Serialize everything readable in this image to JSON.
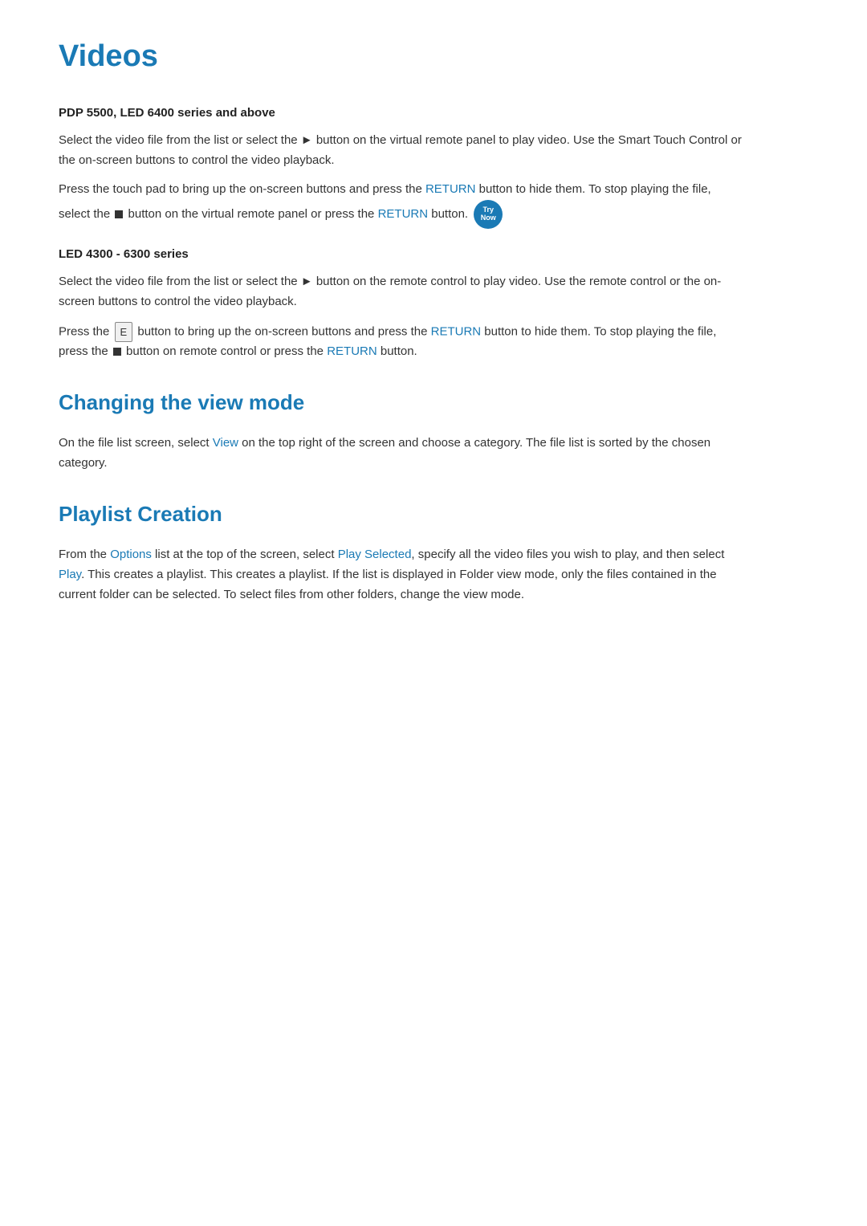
{
  "page": {
    "title": "Videos",
    "accent_color": "#1a7ab5"
  },
  "sections": {
    "pdp_heading": "PDP 5500, LED 6400 series and above",
    "pdp_para1": "Select the video file from the list or select the ► button on the virtual remote panel to play video. Use the Smart Touch Control or the on-screen buttons to control the video playback.",
    "pdp_para2_part1": "Press the touch pad to bring up the on-screen buttons and press the ",
    "pdp_para2_return1": "RETURN",
    "pdp_para2_part2": " button to hide them. To stop playing the file, select the ",
    "pdp_para2_part3": " button on the virtual remote panel or press the ",
    "pdp_para2_return2": "RETURN",
    "pdp_para2_part4": " button.",
    "try_now_line1": "Try",
    "try_now_line2": "Now",
    "led_heading": "LED 4300 - 6300 series",
    "led_para1": "Select the video file from the list or select the ► button on the remote control to play video. Use the remote control or the on-screen buttons to control the video playback.",
    "led_para2_part1": "Press the ",
    "led_para2_e": "E",
    "led_para2_part2": "  button to bring up the on-screen buttons and press the ",
    "led_para2_return1": "RETURN",
    "led_para2_part3": " button to hide them. To stop playing the file, press the ",
    "led_para2_part4": " button on remote control or press the ",
    "led_para2_return2": "RETURN",
    "led_para2_part5": " button.",
    "view_mode_title": "Changing the view mode",
    "view_mode_para_part1": "On the file list screen, select ",
    "view_mode_view": "View",
    "view_mode_para_part2": " on the top right of the screen and choose a category. The file list is sorted by the chosen category.",
    "playlist_title": "Playlist Creation",
    "playlist_para_part1": "From the ",
    "playlist_options": "Options",
    "playlist_para_part2": " list at the top of the screen, select ",
    "playlist_play_selected": "Play Selected",
    "playlist_para_part3": ", specify all the video files you wish to play, and then select ",
    "playlist_play": "Play",
    "playlist_para_part4": ". This creates a playlist. This creates a playlist. If the list is displayed in Folder view mode, only the files contained in the current folder can be selected. To select files from other folders, change the view mode."
  }
}
